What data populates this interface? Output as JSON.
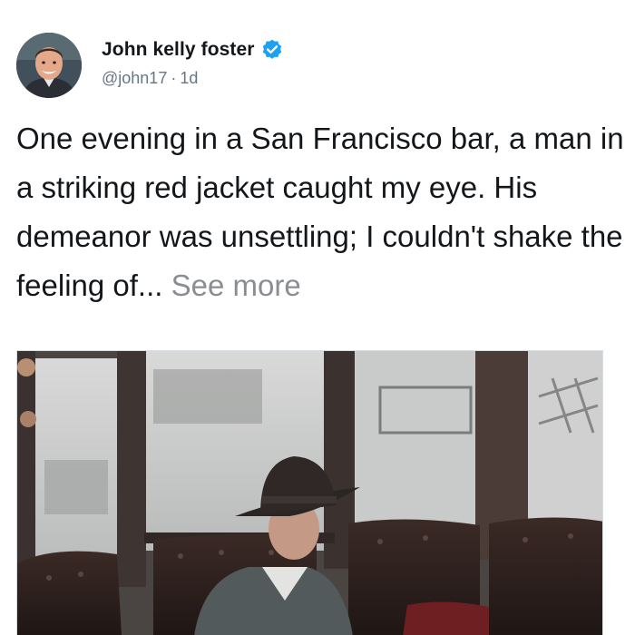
{
  "author": {
    "name": "John kelly foster",
    "handle": "@john17",
    "separator": "·",
    "time": "1d",
    "verified": true,
    "verified_color": "#1da1f2"
  },
  "tweet": {
    "text": "One evening in a San Francisco bar, a man in a striking red jacket caught my eye. His demeanor was unsettling; I couldn't shake the feeling of...",
    "see_more_label": "See more"
  },
  "media": {
    "type": "photo"
  },
  "icons": {
    "verified": "verified-badge-icon",
    "avatar": "profile-photo"
  }
}
